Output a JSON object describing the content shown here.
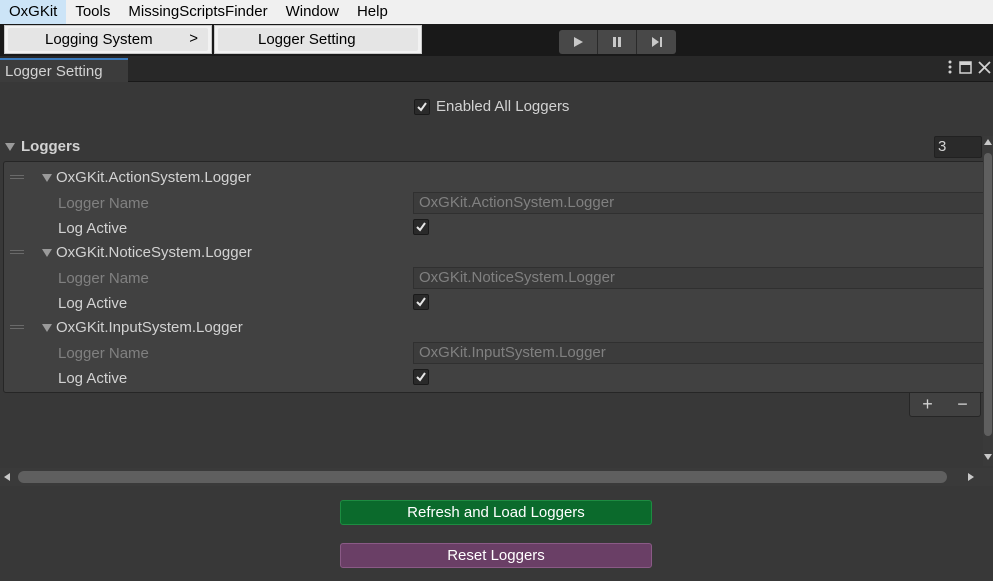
{
  "menubar": {
    "items": [
      "OxGKit",
      "Tools",
      "MissingScriptsFinder",
      "Window",
      "Help"
    ]
  },
  "dropdown": {
    "item1_label": "Logging System",
    "item1_arrow": ">",
    "item2_label": "Logger Setting"
  },
  "toolbar": {
    "play_icon": "play-icon",
    "pause_icon": "pause-icon",
    "step_icon": "step-icon"
  },
  "tab": {
    "title": "Logger Setting"
  },
  "settings": {
    "enabled_all_label": "Enabled All Loggers",
    "enabled_all_checked": true,
    "loggers_label": "Loggers",
    "loggers_count": "3",
    "logger_name_label": "Logger Name",
    "log_active_label": "Log Active",
    "loggers": [
      {
        "title": "OxGKit.ActionSystem.Logger",
        "name": "OxGKit.ActionSystem.Logger",
        "active": true
      },
      {
        "title": "OxGKit.NoticeSystem.Logger",
        "name": "OxGKit.NoticeSystem.Logger",
        "active": true
      },
      {
        "title": "OxGKit.InputSystem.Logger",
        "name": "OxGKit.InputSystem.Logger",
        "active": true
      }
    ],
    "add_label": "+",
    "remove_label": "−"
  },
  "buttons": {
    "refresh_label": "Refresh and Load Loggers",
    "reset_label": "Reset Loggers"
  },
  "colors": {
    "refresh_bg": "#0b6a2c",
    "reset_bg": "#6a3f66",
    "tab_accent": "#3a79bb"
  }
}
